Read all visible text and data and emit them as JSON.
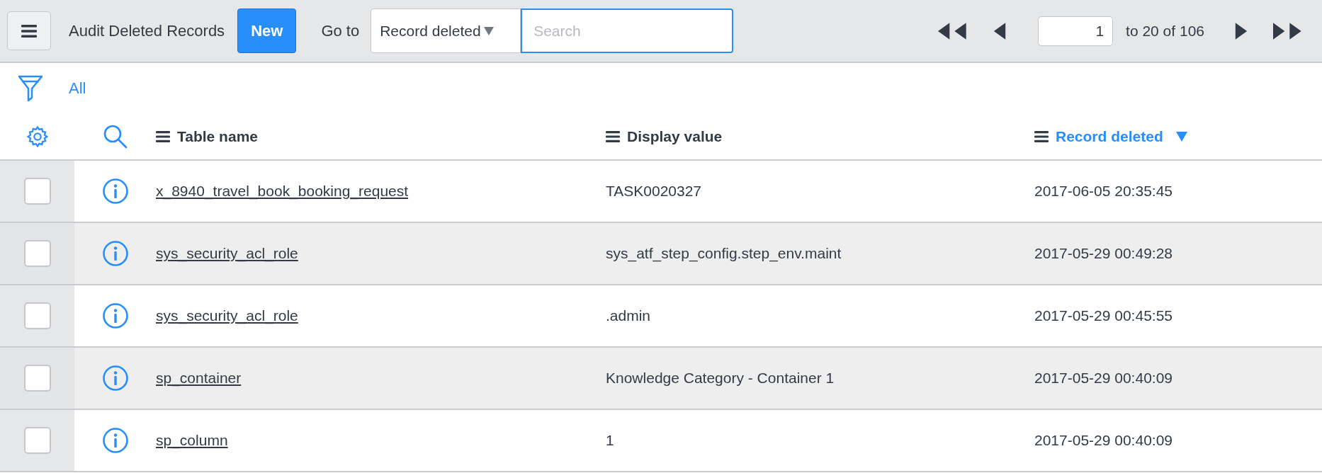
{
  "header": {
    "title": "Audit Deleted Records",
    "new_button": "New",
    "goto_label": "Go to",
    "goto_field": "Record deleted",
    "search": {
      "placeholder": "Search"
    },
    "page": {
      "value": "1",
      "range": "to 20 of 106"
    }
  },
  "filter": {
    "label": "All"
  },
  "table": {
    "columns": [
      {
        "label": "Table name",
        "sorted": false
      },
      {
        "label": "Display value",
        "sorted": false
      },
      {
        "label": "Record deleted",
        "sorted": true
      }
    ],
    "rows": [
      {
        "checked": false,
        "cells": [
          "x_8940_travel_book_booking_request",
          "TASK0020327",
          "2017-06-05 20:35:45"
        ]
      },
      {
        "checked": false,
        "cells": [
          "sys_security_acl_role",
          "sys_atf_step_config.step_env.maint",
          "2017-05-29 00:49:28"
        ]
      },
      {
        "checked": false,
        "cells": [
          "sys_security_acl_role",
          ".admin",
          "2017-05-29 00:45:55"
        ]
      },
      {
        "checked": false,
        "cells": [
          "sp_container",
          "Knowledge Category - Container 1",
          "2017-05-29 00:40:09"
        ]
      },
      {
        "checked": false,
        "cells": [
          "sp_column",
          "1",
          "2017-05-29 00:40:09"
        ]
      }
    ]
  }
}
